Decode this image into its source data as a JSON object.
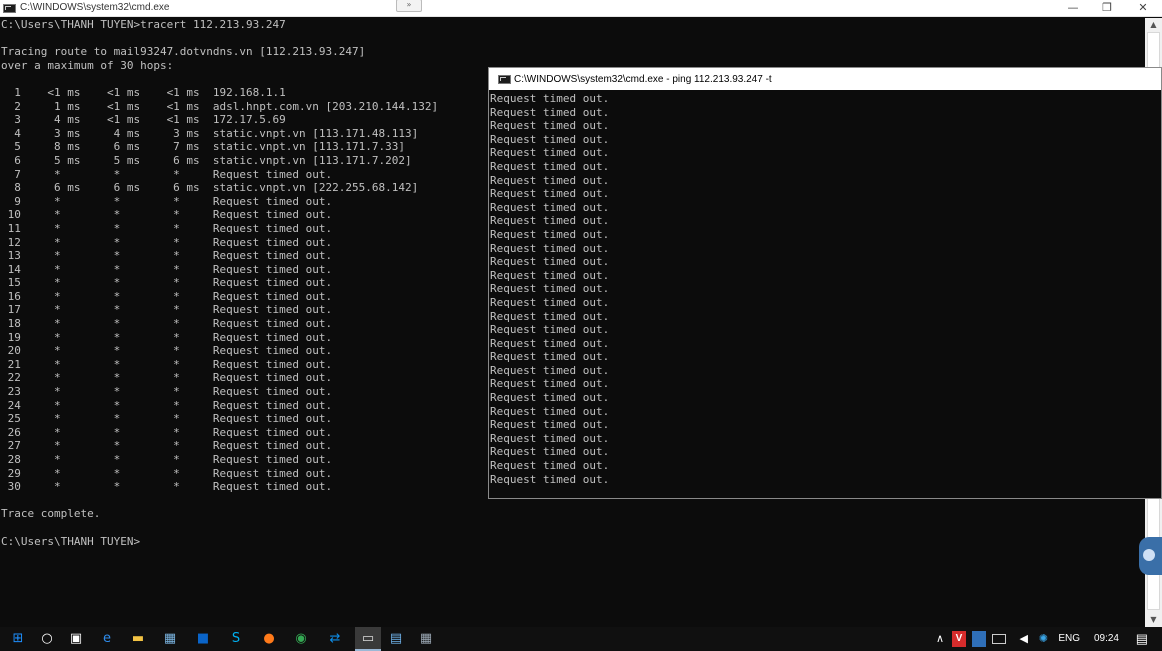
{
  "main_window": {
    "title": "C:\\WINDOWS\\system32\\cmd.exe",
    "collapse_glyph": "»",
    "minimize_glyph": "—",
    "restore_glyph": "❐",
    "close_glyph": "✕",
    "lines": [
      "C:\\Users\\THANH TUYEN>tracert 112.213.93.247",
      "",
      "Tracing route to mail93247.dotvndns.vn [112.213.93.247]",
      "over a maximum of 30 hops:",
      "",
      "  1    <1 ms    <1 ms    <1 ms  192.168.1.1",
      "  2     1 ms    <1 ms    <1 ms  adsl.hnpt.com.vn [203.210.144.132]",
      "  3     4 ms    <1 ms    <1 ms  172.17.5.69",
      "  4     3 ms     4 ms     3 ms  static.vnpt.vn [113.171.48.113]",
      "  5     8 ms     6 ms     7 ms  static.vnpt.vn [113.171.7.33]",
      "  6     5 ms     5 ms     6 ms  static.vnpt.vn [113.171.7.202]",
      "  7     *        *        *     Request timed out.",
      "  8     6 ms     6 ms     6 ms  static.vnpt.vn [222.255.68.142]",
      "  9     *        *        *     Request timed out.",
      " 10     *        *        *     Request timed out.",
      " 11     *        *        *     Request timed out.",
      " 12     *        *        *     Request timed out.",
      " 13     *        *        *     Request timed out.",
      " 14     *        *        *     Request timed out.",
      " 15     *        *        *     Request timed out.",
      " 16     *        *        *     Request timed out.",
      " 17     *        *        *     Request timed out.",
      " 18     *        *        *     Request timed out.",
      " 19     *        *        *     Request timed out.",
      " 20     *        *        *     Request timed out.",
      " 21     *        *        *     Request timed out.",
      " 22     *        *        *     Request timed out.",
      " 23     *        *        *     Request timed out.",
      " 24     *        *        *     Request timed out.",
      " 25     *        *        *     Request timed out.",
      " 26     *        *        *     Request timed out.",
      " 27     *        *        *     Request timed out.",
      " 28     *        *        *     Request timed out.",
      " 29     *        *        *     Request timed out.",
      " 30     *        *        *     Request timed out.",
      "",
      "Trace complete.",
      "",
      "C:\\Users\\THANH TUYEN>"
    ]
  },
  "ping_window": {
    "title": "C:\\WINDOWS\\system32\\cmd.exe - ping  112.213.93.247 -t",
    "lines": [
      "Request timed out.",
      "Request timed out.",
      "Request timed out.",
      "Request timed out.",
      "Request timed out.",
      "Request timed out.",
      "Request timed out.",
      "Request timed out.",
      "Request timed out.",
      "Request timed out.",
      "Request timed out.",
      "Request timed out.",
      "Request timed out.",
      "Request timed out.",
      "Request timed out.",
      "Request timed out.",
      "Request timed out.",
      "Request timed out.",
      "Request timed out.",
      "Request timed out.",
      "Request timed out.",
      "Request timed out.",
      "Request timed out.",
      "Request timed out.",
      "Request timed out.",
      "Request timed out.",
      "Request timed out.",
      "Request timed out.",
      "Request timed out."
    ]
  },
  "scrollbar": {
    "up_glyph": "▲",
    "down_glyph": "▼"
  },
  "taskbar": {
    "icons": [
      {
        "name": "windows-start-icon",
        "glyph": "⊞",
        "color": "#1e90ff"
      },
      {
        "name": "cortana-search-icon",
        "glyph": "○",
        "color": "#ffffff"
      },
      {
        "name": "store-icon",
        "glyph": "▣",
        "color": "#ffffff"
      },
      {
        "name": "internet-explorer-icon",
        "glyph": "e",
        "color": "#2f8ded"
      },
      {
        "name": "file-explorer-icon",
        "glyph": "▬",
        "color": "#f3c344"
      },
      {
        "name": "app-icon",
        "glyph": "▦",
        "color": "#7ab4e0"
      },
      {
        "name": "outlook-icon",
        "glyph": "■",
        "color": "#0a64c8"
      },
      {
        "name": "skype-icon",
        "glyph": "S",
        "color": "#00aff0"
      },
      {
        "name": "firefox-icon",
        "glyph": "●",
        "color": "#ff7a1a"
      },
      {
        "name": "chrome-icon",
        "glyph": "◉",
        "color": "#34a853"
      },
      {
        "name": "teamviewer-icon",
        "glyph": "⇄",
        "color": "#0e8ee9"
      },
      {
        "name": "cmd-icon",
        "glyph": "▭",
        "color": "#dddddd",
        "active": true
      },
      {
        "name": "remote-desktop-icon",
        "glyph": "▤",
        "color": "#6fb2ea"
      },
      {
        "name": "calculator-icon",
        "glyph": "▦",
        "color": "#9aa7b3"
      }
    ],
    "tray": {
      "chevron_glyph": "∧",
      "language": "ENG",
      "time": "09:24",
      "notification_glyph": "▤"
    }
  }
}
